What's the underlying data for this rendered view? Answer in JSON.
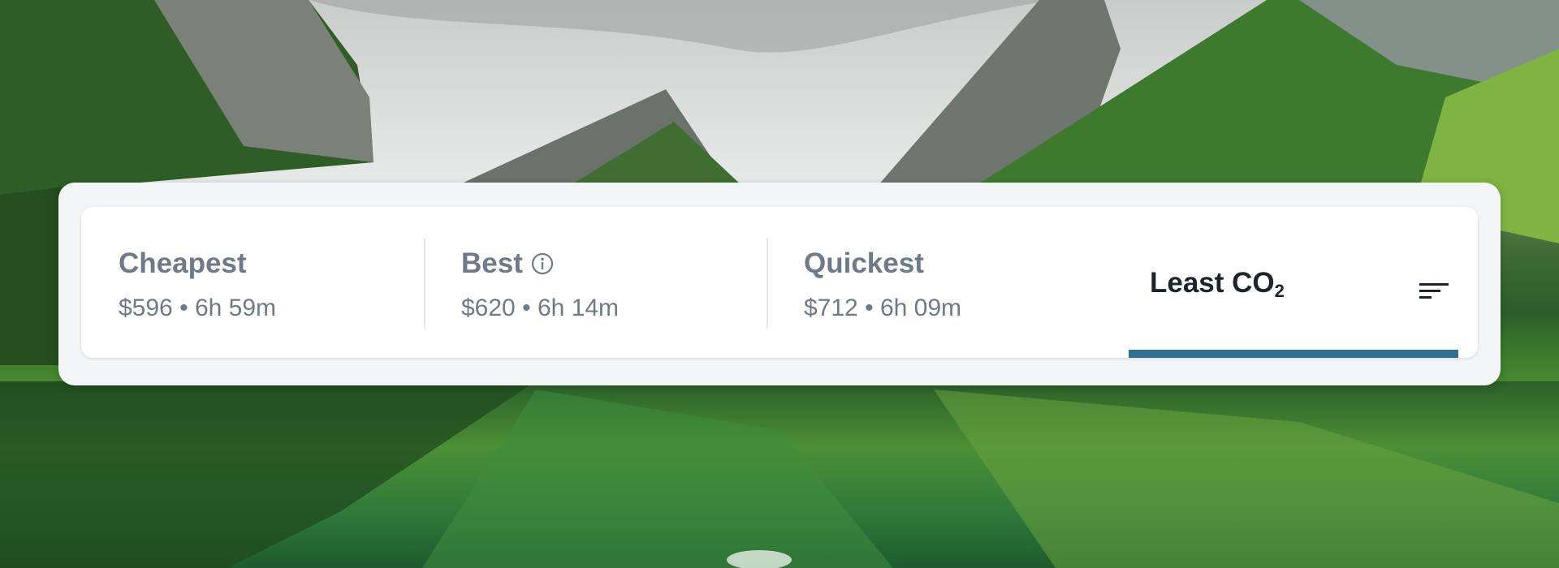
{
  "tabs": [
    {
      "title": "Cheapest",
      "price": "$596",
      "duration": "6h 59m",
      "separator": "•"
    },
    {
      "title": "Best",
      "price": "$620",
      "duration": "6h 14m",
      "separator": "•",
      "icon": "info-icon"
    },
    {
      "title": "Quickest",
      "price": "$712",
      "duration": "6h 09m",
      "separator": "•"
    },
    {
      "title": "Least CO",
      "subscript": "2",
      "selected": true,
      "icon": "sort-icon"
    }
  ],
  "colors": {
    "accent": "#2f6f8f",
    "text_muted": "#6e7a88",
    "text_selected": "#1f242b"
  }
}
